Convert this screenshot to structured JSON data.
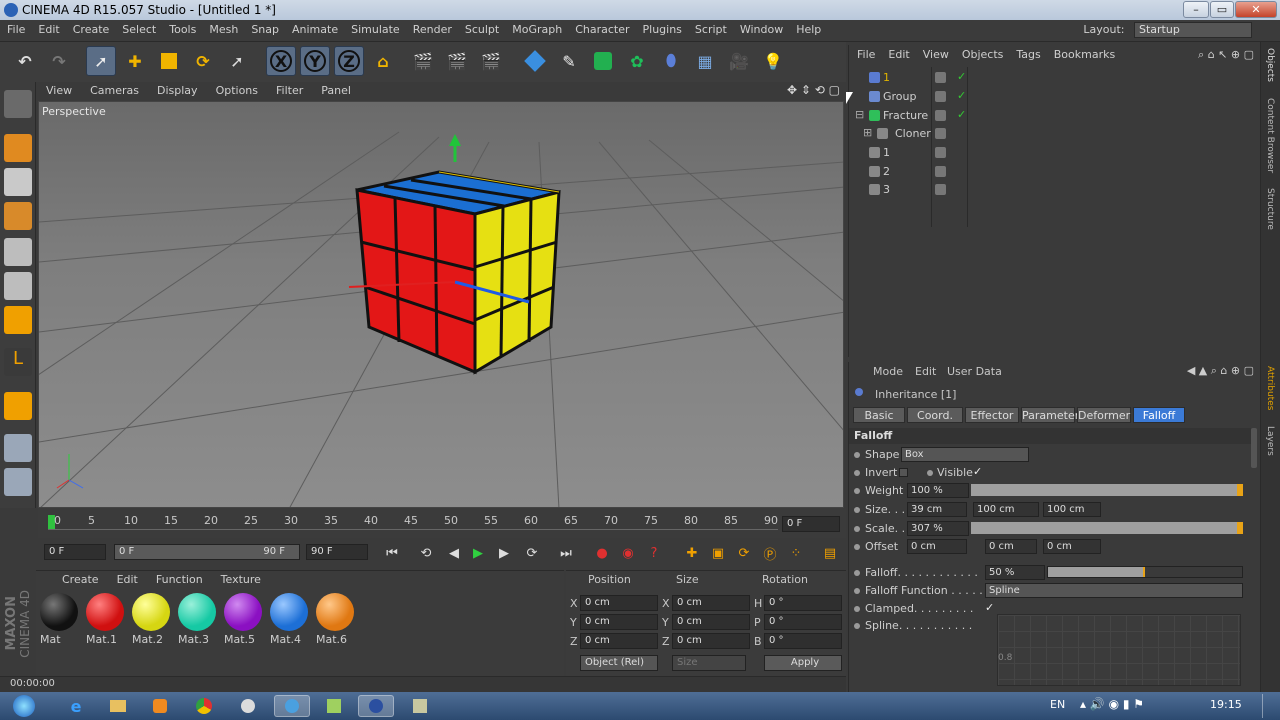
{
  "window": {
    "title": "CINEMA 4D R15.057 Studio - [Untitled 1 *]"
  },
  "menubar": {
    "items": [
      "File",
      "Edit",
      "Create",
      "Select",
      "Tools",
      "Mesh",
      "Snap",
      "Animate",
      "Simulate",
      "Render",
      "Sculpt",
      "MoGraph",
      "Character",
      "Plugins",
      "Script",
      "Window",
      "Help"
    ]
  },
  "layout": {
    "label": "Layout:",
    "value": "Startup"
  },
  "viewport": {
    "menu": [
      "View",
      "Cameras",
      "Display",
      "Options",
      "Filter",
      "Panel"
    ],
    "label": "Perspective"
  },
  "timeline": {
    "ticks": [
      "0",
      "5",
      "10",
      "15",
      "20",
      "25",
      "30",
      "35",
      "40",
      "45",
      "50",
      "55",
      "60",
      "65",
      "70",
      "75",
      "80",
      "85",
      "90"
    ],
    "current_frame": "0 F"
  },
  "transport": {
    "start": "0 F",
    "range_start": "0 F",
    "range_end": "90 F",
    "end": "90 F"
  },
  "materials": {
    "menu": [
      "Create",
      "Edit",
      "Function",
      "Texture"
    ],
    "items": [
      {
        "name": "Mat",
        "color": "#111111"
      },
      {
        "name": "Mat.1",
        "color": "#d01010"
      },
      {
        "name": "Mat.2",
        "color": "#d6d612"
      },
      {
        "name": "Mat.3",
        "color": "#16c9a4"
      },
      {
        "name": "Mat.5",
        "color": "#8b10c2"
      },
      {
        "name": "Mat.4",
        "color": "#1d6fd6"
      },
      {
        "name": "Mat.6",
        "color": "#e07812"
      }
    ]
  },
  "coords": {
    "headers": [
      "Position",
      "Size",
      "Rotation"
    ],
    "rows": [
      {
        "p_axis": "X",
        "p_val": "0 cm",
        "s_axis": "X",
        "s_val": "0 cm",
        "r_axis": "H",
        "r_val": "0 °"
      },
      {
        "p_axis": "Y",
        "p_val": "0 cm",
        "s_axis": "Y",
        "s_val": "0 cm",
        "r_axis": "P",
        "r_val": "0 °"
      },
      {
        "p_axis": "Z",
        "p_val": "0 cm",
        "s_axis": "Z",
        "s_val": "0 cm",
        "r_axis": "B",
        "r_val": "0 °"
      }
    ],
    "mode": "Object (Rel)",
    "size_mode": "Size",
    "apply": "Apply"
  },
  "statusbar": {
    "time": "00:00:00"
  },
  "objects": {
    "menu": [
      "File",
      "Edit",
      "View",
      "Objects",
      "Tags",
      "Bookmarks"
    ],
    "rows": [
      {
        "name": "1",
        "color": "#e0b400"
      },
      {
        "name": "Group",
        "color": "#cfcfcf"
      },
      {
        "name": "Fracture",
        "color": "#cfcfcf"
      },
      {
        "name": "Cloner",
        "color": "#cfcfcf"
      },
      {
        "name": "1",
        "color": "#cfcfcf"
      },
      {
        "name": "2",
        "color": "#cfcfcf"
      },
      {
        "name": "3",
        "color": "#cfcfcf"
      }
    ]
  },
  "attributes": {
    "menu": [
      "Mode",
      "Edit",
      "User Data"
    ],
    "object": "Inheritance [1]",
    "tabs": [
      "Basic",
      "Coord.",
      "Effector",
      "Parameter",
      "Deformer",
      "Falloff"
    ],
    "active_tab": "Falloff",
    "section": "Falloff",
    "shape_label": "Shape",
    "shape_value": "Box",
    "invert_label": "Invert",
    "visible_label": "Visible",
    "weight_label": "Weight",
    "weight_value": "100 %",
    "weight_fraction": 1.0,
    "size_label": "Size. . .",
    "size_values": [
      "39 cm",
      "100 cm",
      "100 cm"
    ],
    "scale_label": "Scale. .",
    "scale_value": "307 %",
    "offset_label": "Offset",
    "offset_values": [
      "0 cm",
      "0 cm",
      "0 cm"
    ],
    "falloff_label": "Falloff. . . . . . . . . . . .",
    "falloff_value": "50 %",
    "falloff_fraction": 0.5,
    "falloff_fn_label": "Falloff Function . . . . .",
    "falloff_fn_value": "Spline",
    "clamped_label": "Clamped. . . . . . . . .",
    "spline_label": "Spline. . . . . . . . . . .",
    "spline_tick": "0.8"
  },
  "side_tabs": [
    "Objects",
    "Content Browser",
    "Structure"
  ],
  "side_tabs_lower": [
    "Attributes",
    "Layers"
  ],
  "taskbar": {
    "lang": "EN",
    "clock": "19:15"
  }
}
